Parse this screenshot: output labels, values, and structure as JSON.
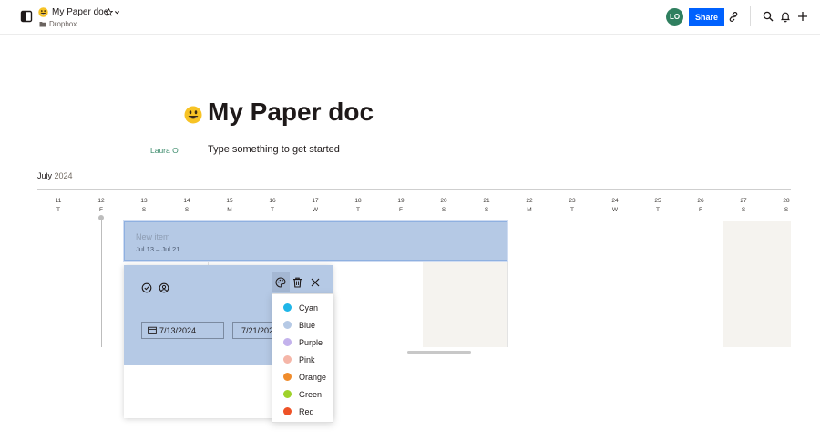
{
  "topbar": {
    "doc_title": "My Paper doc",
    "breadcrumb": "Dropbox",
    "avatar_initials": "LO",
    "share_label": "Share"
  },
  "document": {
    "title": "My Paper doc",
    "author": "Laura O",
    "placeholder": "Type something to get started"
  },
  "timeline": {
    "month": "July",
    "year": "2024",
    "days": [
      {
        "num": "11",
        "dow": "T"
      },
      {
        "num": "12",
        "dow": "F"
      },
      {
        "num": "13",
        "dow": "S"
      },
      {
        "num": "14",
        "dow": "S"
      },
      {
        "num": "15",
        "dow": "M"
      },
      {
        "num": "16",
        "dow": "T"
      },
      {
        "num": "17",
        "dow": "W"
      },
      {
        "num": "18",
        "dow": "T"
      },
      {
        "num": "19",
        "dow": "F"
      },
      {
        "num": "20",
        "dow": "S"
      },
      {
        "num": "21",
        "dow": "S"
      },
      {
        "num": "22",
        "dow": "M"
      },
      {
        "num": "23",
        "dow": "T"
      },
      {
        "num": "24",
        "dow": "W"
      },
      {
        "num": "25",
        "dow": "T"
      },
      {
        "num": "26",
        "dow": "F"
      },
      {
        "num": "27",
        "dow": "S"
      },
      {
        "num": "28",
        "dow": "S"
      }
    ],
    "item": {
      "title": "New item",
      "dates": "Jul 13 – Jul 21"
    }
  },
  "editor": {
    "start_date": "7/13/2024",
    "end_date": "7/21/2024"
  },
  "color_menu": {
    "options": [
      {
        "label": "Cyan",
        "color": "#1fb6e8"
      },
      {
        "label": "Blue",
        "color": "#b5c9e5"
      },
      {
        "label": "Purple",
        "color": "#c3b2ec"
      },
      {
        "label": "Pink",
        "color": "#f5b6a8"
      },
      {
        "label": "Orange",
        "color": "#f08c2c"
      },
      {
        "label": "Green",
        "color": "#9fd22a"
      },
      {
        "label": "Red",
        "color": "#ee5227"
      }
    ]
  },
  "colors": {
    "accent": "#0061fe",
    "item_fill": "#b5c9e5",
    "avatar": "#2f7f5f"
  },
  "icons": {
    "sidebar_toggle": "sidebar-toggle-icon",
    "star": "star-icon",
    "chevron": "chevron-down-icon",
    "folder": "folder-icon",
    "link": "link-icon",
    "search": "search-icon",
    "bell": "bell-icon",
    "plus": "plus-icon",
    "check_circle": "check-circle-icon",
    "person": "person-icon",
    "palette": "palette-icon",
    "trash": "trash-icon",
    "close": "close-icon",
    "calendar": "calendar-icon"
  }
}
